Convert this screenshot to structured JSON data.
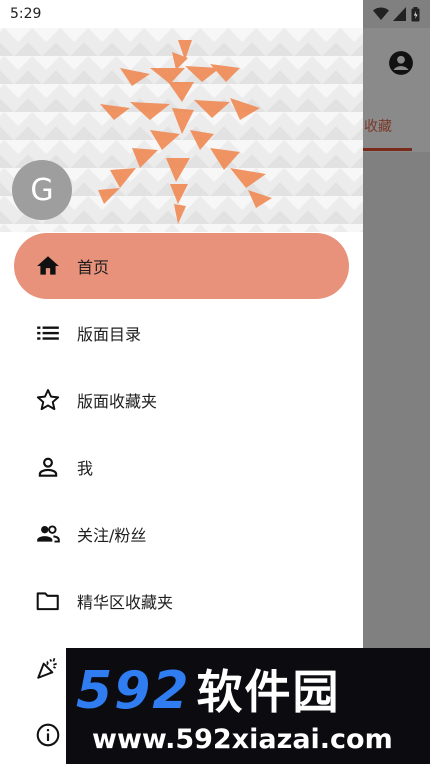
{
  "status_bar": {
    "time": "5:29",
    "icons": [
      "wifi-icon",
      "signal-icon",
      "battery-icon"
    ]
  },
  "app_background": {
    "tab_label": "收藏"
  },
  "drawer": {
    "avatar_letter": "G",
    "menu": [
      {
        "label": "首页",
        "icon": "home-icon",
        "active": true
      },
      {
        "label": "版面目录",
        "icon": "list-icon",
        "active": false
      },
      {
        "label": "版面收藏夹",
        "icon": "star-icon",
        "active": false
      },
      {
        "label": "我",
        "icon": "person-icon",
        "active": false
      },
      {
        "label": "关注/粉丝",
        "icon": "people-icon",
        "active": false
      },
      {
        "label": "精华区收藏夹",
        "icon": "folder-icon",
        "active": false
      },
      {
        "label": "",
        "icon": "party-popper-icon",
        "active": false
      },
      {
        "label": "",
        "icon": "info-icon",
        "active": false
      }
    ]
  },
  "watermark": {
    "top": "592",
    "top_cn": "软件园",
    "bottom": "www.592xiazai.com"
  },
  "colors": {
    "accent": "#e8927c",
    "drawer_bg": "#ffffff",
    "scrim": "#808080"
  }
}
